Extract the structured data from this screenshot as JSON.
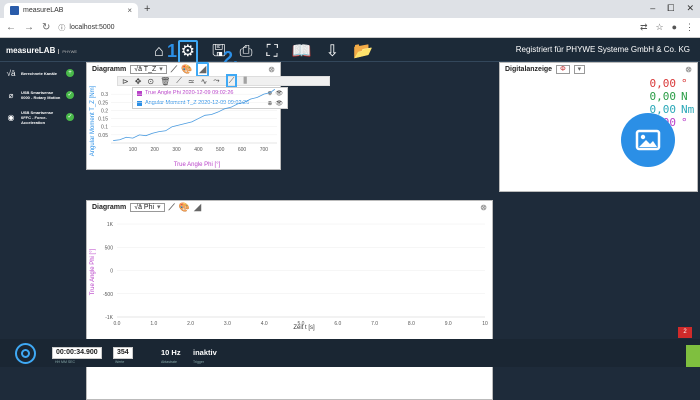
{
  "browser": {
    "tab_title": "measureLAB",
    "new_tab": "+",
    "tab_close": "×",
    "url": "localhost:5000",
    "window_controls": [
      "–",
      "⧠",
      "✕"
    ]
  },
  "app": {
    "logo": "measureLAB",
    "logo_sub": "PHYWE",
    "registered": "Registriert für PHYWE Systeme GmbH & Co. KG",
    "callout_1": "1",
    "callout_2": "2."
  },
  "sidebar": {
    "items": [
      {
        "label": "Berechnete Kanäle",
        "icon": "sqrt-icon"
      },
      {
        "label": "USB Smartsense 0000 - Rotary Motion",
        "icon": "rotary-sensor-icon"
      },
      {
        "label": "USB Smartsense 0FFC - Force-Acceleration",
        "icon": "force-sensor-icon"
      }
    ]
  },
  "panel1": {
    "title": "Diagramm",
    "channel": "√ā T_Z",
    "legend": [
      {
        "label": "True Angle Phi 2020-12-09 09:02:26",
        "color": "#b840c8"
      },
      {
        "label": "Angular Moment T_Z 2020-12-09 09:02:26",
        "color": "#2b8fe6"
      }
    ],
    "ylabel": "Angular Moment T_Z [Nm]",
    "xlabel": "True Angle Phi [°]"
  },
  "panel2": {
    "title": "Diagramm",
    "channel": "√ā Phi",
    "ylabel": "True Angle Phi [°]",
    "xlabel": "Zeit t [s]"
  },
  "digital": {
    "title": "Digitalanzeige",
    "channel": "Φ",
    "rows": [
      {
        "value": "0,00",
        "unit": "°",
        "color": "#d93a3a"
      },
      {
        "value": "0,00",
        "unit": "N",
        "color": "#2a9d46"
      },
      {
        "value": "0,00",
        "unit": "Nm",
        "color": "#2aa8b8"
      },
      {
        "value": "0,00",
        "unit": "°",
        "color": "#b840c8"
      }
    ]
  },
  "status": {
    "time": "00:00:34.900",
    "time_caption": "HH  MM  SEC",
    "count": "354",
    "count_caption": "Werte",
    "rate": "10 Hz",
    "rate_caption": "Abtastrate",
    "trigger": "inaktiv",
    "trigger_caption": "Trigger"
  },
  "notification_count": "2",
  "chart_data": [
    {
      "type": "line",
      "xlabel": "True Angle Phi [°]",
      "ylabel": "Angular Moment T_Z [Nm]",
      "xlim": [
        0,
        760
      ],
      "ylim": [
        0,
        0.35
      ],
      "xticks": [
        100,
        200,
        300,
        400,
        500,
        600,
        700
      ],
      "yticks": [
        0.05,
        0.1,
        0.15,
        0.2,
        0.25,
        0.3
      ],
      "series": [
        {
          "name": "Angular Moment T_Z 2020-12-09 09:02:26",
          "color": "#4a9be0",
          "x": [
            10,
            40,
            70,
            100,
            130,
            160,
            190,
            220,
            250,
            280,
            310,
            340,
            370,
            400,
            430,
            460,
            490,
            520,
            550,
            580,
            610,
            640,
            670,
            700,
            730,
            750
          ],
          "y": [
            0.015,
            0.02,
            0.035,
            0.03,
            0.05,
            0.045,
            0.06,
            0.07,
            0.075,
            0.1,
            0.11,
            0.12,
            0.13,
            0.15,
            0.17,
            0.175,
            0.19,
            0.21,
            0.22,
            0.24,
            0.25,
            0.27,
            0.28,
            0.3,
            0.31,
            0.33
          ]
        }
      ]
    },
    {
      "type": "line",
      "xlabel": "Zeit t [s]",
      "ylabel": "True Angle Phi [°]",
      "xlim": [
        0,
        10
      ],
      "ylim": [
        -1000,
        1000
      ],
      "xticks": [
        "0.0",
        "1.0",
        "2.0",
        "3.0",
        "4.0",
        "5.0",
        "6.0",
        "7.0",
        "8.0",
        "9.0",
        "10"
      ],
      "yticks": [
        "1K",
        "500",
        "0",
        "-500",
        "-1K"
      ]
    }
  ]
}
